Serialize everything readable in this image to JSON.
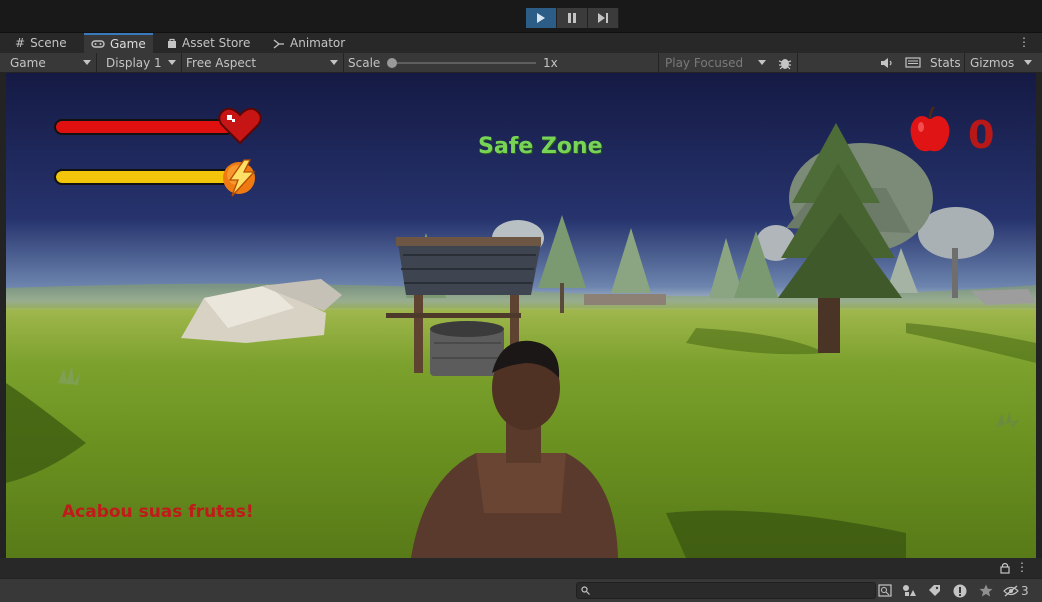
{
  "playbar": {
    "play_icon": "play-icon",
    "pause_icon": "pause-icon",
    "step_icon": "step-icon"
  },
  "tabs": [
    {
      "label": "Scene",
      "icon": "grid-icon"
    },
    {
      "label": "Game",
      "icon": "gamepad-icon"
    },
    {
      "label": "Asset Store",
      "icon": "bag-icon"
    },
    {
      "label": "Animator",
      "icon": "animator-icon"
    }
  ],
  "toolbar": {
    "view_select": "Game",
    "display_select": "Display 1",
    "aspect_select": "Free Aspect",
    "scale_label": "Scale",
    "scale_value": "1x",
    "scale_level": 0.0,
    "play_mode": "Play Focused",
    "stats_label": "Stats",
    "gizmos_label": "Gizmos"
  },
  "hud": {
    "title": "Safe Zone",
    "fruit_count": "0",
    "message": "Acabou suas frutas!",
    "health_level": 1.0,
    "energy_level": 1.0,
    "colors": {
      "health": "#e01010",
      "energy": "#f2c40a",
      "title": "#78d456",
      "message": "#c01a1a",
      "counter": "#b81818"
    }
  },
  "bottom": {
    "hidden_count": "3"
  }
}
